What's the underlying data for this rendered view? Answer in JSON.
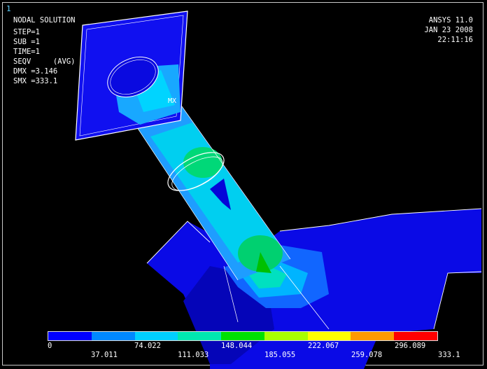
{
  "window_number": "1",
  "info": {
    "title": "NODAL SOLUTION",
    "step": "STEP=1",
    "sub": "SUB =1",
    "time": "TIME=1",
    "result": "SEQV     (AVG)",
    "dmx": "DMX =3.146",
    "smx": "SMX =333.1"
  },
  "header_right": {
    "product": "ANSYS 11.0",
    "date": "JAN 23 2008",
    "time": "22:11:16"
  },
  "max_marker": "MX",
  "legend": {
    "colors": [
      "#0000ff",
      "#0088ff",
      "#00d0ff",
      "#00e8b0",
      "#00e000",
      "#a8ff00",
      "#ffff00",
      "#ff9900",
      "#ff0000"
    ],
    "upper_labels": [
      "0",
      "74.022",
      "148.044",
      "222.067",
      "296.089"
    ],
    "lower_labels": [
      "37.011",
      "111.033",
      "185.055",
      "259.078",
      "333.1"
    ]
  }
}
